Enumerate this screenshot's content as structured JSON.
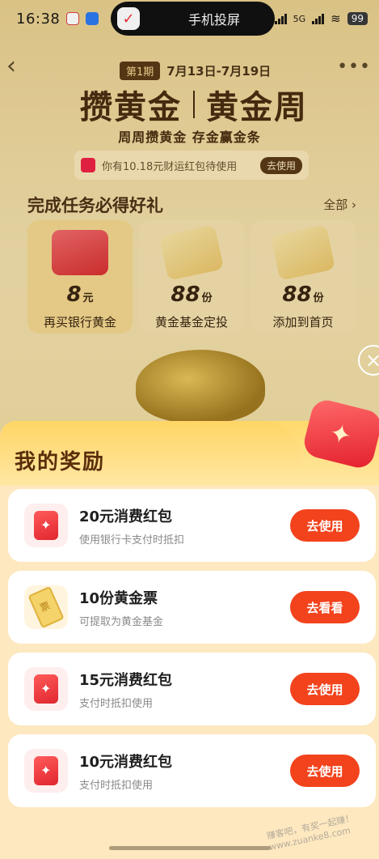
{
  "status": {
    "time": "16:38",
    "screen_cast": "手机投屏",
    "signal1": "5G",
    "signal2": "5G",
    "battery": "99"
  },
  "hero": {
    "period_badge": "第1期",
    "period_dates": "7月13日-7月19日",
    "title_left": "攒黄金",
    "title_right": "黄金周",
    "subtitle": "周周攒黄金 存金赢金条",
    "coupon_text": "你有10.18元财运红包待使用",
    "coupon_button": "去使用"
  },
  "tasks": {
    "title": "完成任务必得好礼",
    "all_label": "全部",
    "items": [
      {
        "value": "8",
        "unit": "元",
        "label": "再买银行黄金",
        "badge": "消费红包"
      },
      {
        "value": "88",
        "unit": "份",
        "label": "黄金基金定投",
        "badge": "黄金票"
      },
      {
        "value": "88",
        "unit": "份",
        "label": "添加到首页",
        "badge": "黄金票"
      }
    ]
  },
  "rewards": {
    "title": "我的奖励",
    "items": [
      {
        "name": "20元消费红包",
        "desc": "使用银行卡支付时抵扣",
        "button": "去使用",
        "icon": "red-envelope-icon"
      },
      {
        "name": "10份黄金票",
        "desc": "可提取为黄金基金",
        "button": "去看看",
        "icon": "gold-ticket-icon"
      },
      {
        "name": "15元消费红包",
        "desc": "支付时抵扣使用",
        "button": "去使用",
        "icon": "red-envelope-icon"
      },
      {
        "name": "10元消费红包",
        "desc": "支付时抵扣使用",
        "button": "去使用",
        "icon": "red-envelope-icon"
      }
    ]
  },
  "watermark": "赚客吧，有奖一起赚！ www.zuanke8.com",
  "colors": {
    "accent_button": "#f2431d",
    "panel_bg": "#fde8c0",
    "hero_text": "#4a2d10"
  }
}
